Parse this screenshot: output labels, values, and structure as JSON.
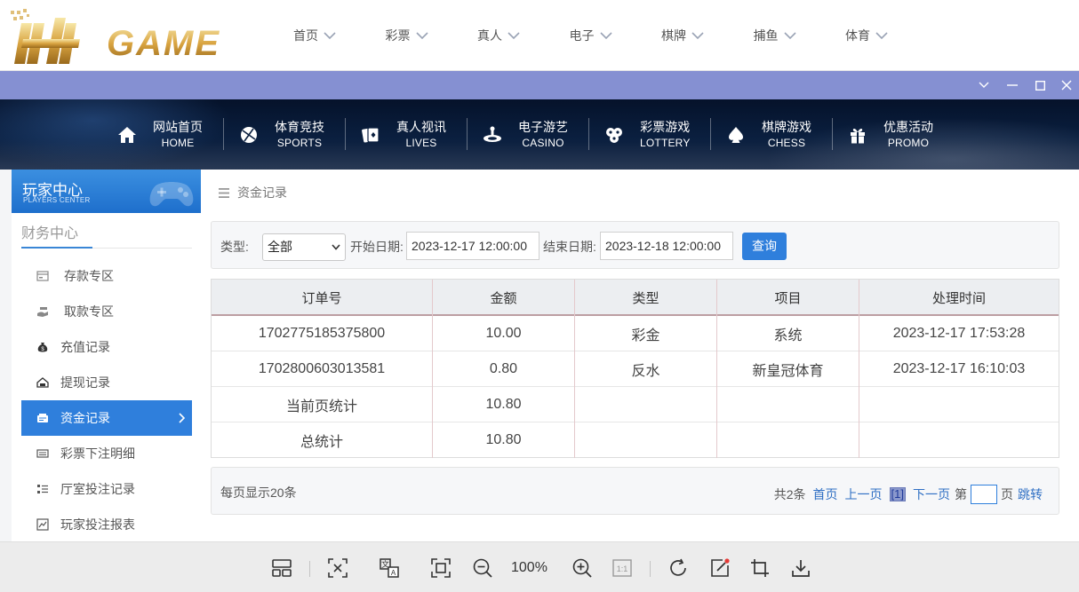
{
  "site": {
    "logo_text": "HH GAME",
    "top_nav": [
      {
        "label": "首页"
      },
      {
        "label": "彩票"
      },
      {
        "label": "真人"
      },
      {
        "label": "电子"
      },
      {
        "label": "棋牌"
      },
      {
        "label": "捕鱼"
      },
      {
        "label": "体育"
      }
    ]
  },
  "banner_nav": [
    {
      "cn": "网站首页",
      "en": "HOME",
      "icon": "home-icon"
    },
    {
      "cn": "体育竞技",
      "en": "SPORTS",
      "icon": "ball-icon"
    },
    {
      "cn": "真人视讯",
      "en": "LIVES",
      "icon": "cards-icon"
    },
    {
      "cn": "电子游艺",
      "en": "CASINO",
      "icon": "roulette-icon"
    },
    {
      "cn": "彩票游戏",
      "en": "LOTTERY",
      "icon": "lottery-balls-icon"
    },
    {
      "cn": "棋牌游戏",
      "en": "CHESS",
      "icon": "spade-icon"
    },
    {
      "cn": "优惠活动",
      "en": "PROMO",
      "icon": "gift-icon"
    }
  ],
  "sidebar": {
    "header_cn": "玩家中心",
    "header_en": "PLAYERS CENTER",
    "section_title": "财务中心",
    "items": [
      {
        "label": "存款专区",
        "icon": "deposit-icon",
        "active": false
      },
      {
        "label": "取款专区",
        "icon": "withdraw-icon",
        "active": false
      },
      {
        "label": "充值记录",
        "icon": "moneybag-icon",
        "active": false
      },
      {
        "label": "提现记录",
        "icon": "cash-out-icon",
        "active": false
      },
      {
        "label": "资金记录",
        "icon": "funds-icon",
        "active": true
      },
      {
        "label": "彩票下注明细",
        "icon": "ticket-icon",
        "active": false
      },
      {
        "label": "厅室投注记录",
        "icon": "list-icon",
        "active": false
      },
      {
        "label": "玩家投注报表",
        "icon": "report-icon",
        "active": false
      }
    ]
  },
  "breadcrumb": "资金记录",
  "filter": {
    "type_label": "类型:",
    "type_value": "全部",
    "start_label": "开始日期:",
    "start_value": "2023-12-17 12:00:00",
    "end_label": "结束日期:",
    "end_value": "2023-12-18 12:00:00",
    "query_label": "查询"
  },
  "table": {
    "headers": [
      "订单号",
      "金额",
      "类型",
      "项目",
      "处理时间"
    ],
    "rows": [
      [
        "1702775185375800",
        "10.00",
        "彩金",
        "系统",
        "2023-12-17 17:53:28"
      ],
      [
        "1702800603013581",
        "0.80",
        "反水",
        "新皇冠体育",
        "2023-12-17 16:10:03"
      ],
      [
        "当前页统计",
        "10.80",
        "",
        "",
        ""
      ],
      [
        "总统计",
        "10.80",
        "",
        "",
        ""
      ]
    ]
  },
  "pager": {
    "per_page_text": "每页显示20条",
    "total_text": "共2条",
    "first": "首页",
    "prev": "上一页",
    "current": "[1]",
    "next": "下一页",
    "di": "第",
    "ye": "页",
    "jump": "跳转"
  },
  "viewer": {
    "zoom": "100%"
  },
  "colors": {
    "accent": "#2f7fdc",
    "window_bar": "#8590d2",
    "banner_bg": "#0a1f3f"
  }
}
